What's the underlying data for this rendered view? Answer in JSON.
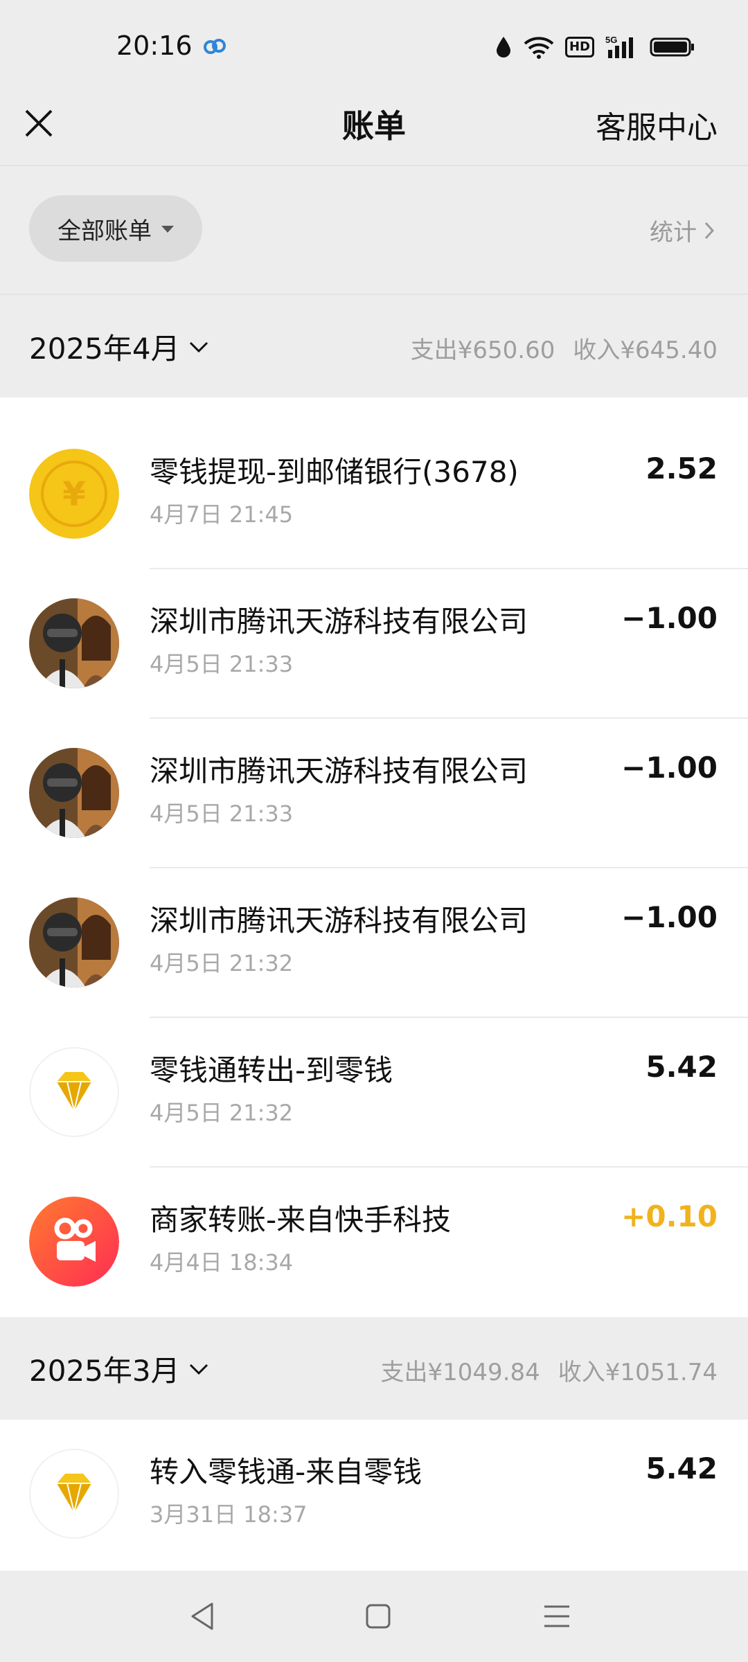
{
  "status_bar": {
    "time": "20:16",
    "hd": "HD",
    "network": "5G"
  },
  "nav": {
    "title": "账单",
    "customer_service": "客服中心"
  },
  "filter": {
    "label": "全部账单",
    "stats": "统计"
  },
  "months": [
    {
      "label": "2025年4月",
      "expense": "支出¥650.60",
      "income": "收入¥645.40"
    },
    {
      "label": "2025年3月",
      "expense": "支出¥1049.84",
      "income": "收入¥1051.74"
    }
  ],
  "april_transactions": [
    {
      "icon": "yuan-coin-icon",
      "title": "零钱提现-到邮储银行(3678)",
      "time": "4月7日 21:45",
      "amount": "2.52"
    },
    {
      "icon": "game-avatar",
      "title": "深圳市腾讯天游科技有限公司",
      "time": "4月5日 21:33",
      "amount": "−1.00"
    },
    {
      "icon": "game-avatar",
      "title": "深圳市腾讯天游科技有限公司",
      "time": "4月5日 21:33",
      "amount": "−1.00"
    },
    {
      "icon": "game-avatar",
      "title": "深圳市腾讯天游科技有限公司",
      "time": "4月5日 21:32",
      "amount": "−1.00"
    },
    {
      "icon": "diamond-icon",
      "title": "零钱通转出-到零钱",
      "time": "4月5日 21:32",
      "amount": "5.42"
    },
    {
      "icon": "kuaishou-icon",
      "title": "商家转账-来自快手科技",
      "time": "4月4日 18:34",
      "amount": "+0.10"
    }
  ],
  "march_transactions": [
    {
      "icon": "diamond-icon",
      "title": "转入零钱通-来自零钱",
      "time": "3月31日 18:37",
      "amount": "5.42"
    }
  ],
  "colors": {
    "income": "#f1b21c",
    "coin": "#f5c518",
    "background": "#ededed"
  }
}
